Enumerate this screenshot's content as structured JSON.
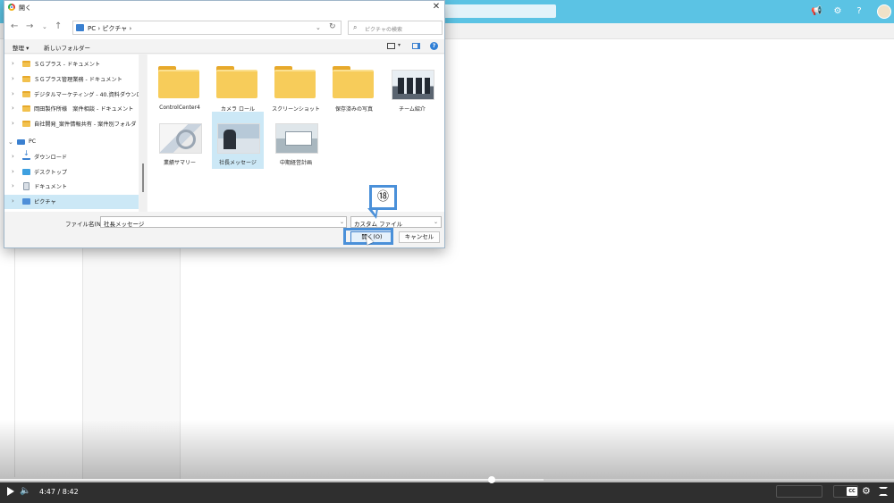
{
  "dialog": {
    "title": "開く",
    "address_segments": [
      "PC",
      "ピクチャ"
    ],
    "address_text": "PC  ›  ピクチャ  ›",
    "search_placeholder": "ピクチャの検索",
    "toolbar": {
      "organize": "整理 ▾",
      "new_folder": "新しいフォルダー"
    },
    "nav_tree": [
      {
        "label": "ＳＧプラス - ドキュメント",
        "icon": "folder-icon"
      },
      {
        "label": "ＳＧプラス管理業務 - ドキュメント",
        "icon": "folder-icon"
      },
      {
        "label": "デジタルマーケティング - 40.資料ダウンロード",
        "icon": "folder-icon"
      },
      {
        "label": "岡田製作所様　案件相談 - ドキュメント",
        "icon": "folder-icon"
      },
      {
        "label": "自社開発_案件情報共有 - 案件別フォルダ",
        "icon": "folder-icon"
      },
      {
        "label": "PC",
        "icon": "pc-icon"
      },
      {
        "label": "ダウンロード",
        "icon": "download-icon"
      },
      {
        "label": "デスクトップ",
        "icon": "desktop-icon"
      },
      {
        "label": "ドキュメント",
        "icon": "document-icon"
      },
      {
        "label": "ピクチャ",
        "icon": "pictures-icon",
        "selected": true
      }
    ],
    "files": [
      {
        "name": "ControlCenter4",
        "kind": "folder"
      },
      {
        "name": "カメラ ロール",
        "kind": "folder"
      },
      {
        "name": "スクリーンショット",
        "kind": "folder"
      },
      {
        "name": "保存済みの写真",
        "kind": "folder"
      },
      {
        "name": "チーム紹介",
        "kind": "image"
      },
      {
        "name": "業績サマリー",
        "kind": "image"
      },
      {
        "name": "社長メッセージ",
        "kind": "image",
        "selected": true
      },
      {
        "name": "中期経営計画",
        "kind": "image"
      }
    ],
    "filename_label": "ファイル名(N):",
    "filename_value": "社長メッセージ",
    "filetype_value": "カスタム ファイル",
    "open_label": "開く(O)",
    "cancel_label": "キャンセル"
  },
  "annotation": {
    "step": "⑱",
    "color": "#4a90d9"
  },
  "player": {
    "time_current": "4:47",
    "time_separator": "/",
    "time_total": "8:42",
    "progress_fraction": 0.55,
    "cc_label": "CC"
  },
  "colors": {
    "app_header": "#5bc3e4",
    "selection": "#cce8f6",
    "folder": "#f7cc5a"
  }
}
